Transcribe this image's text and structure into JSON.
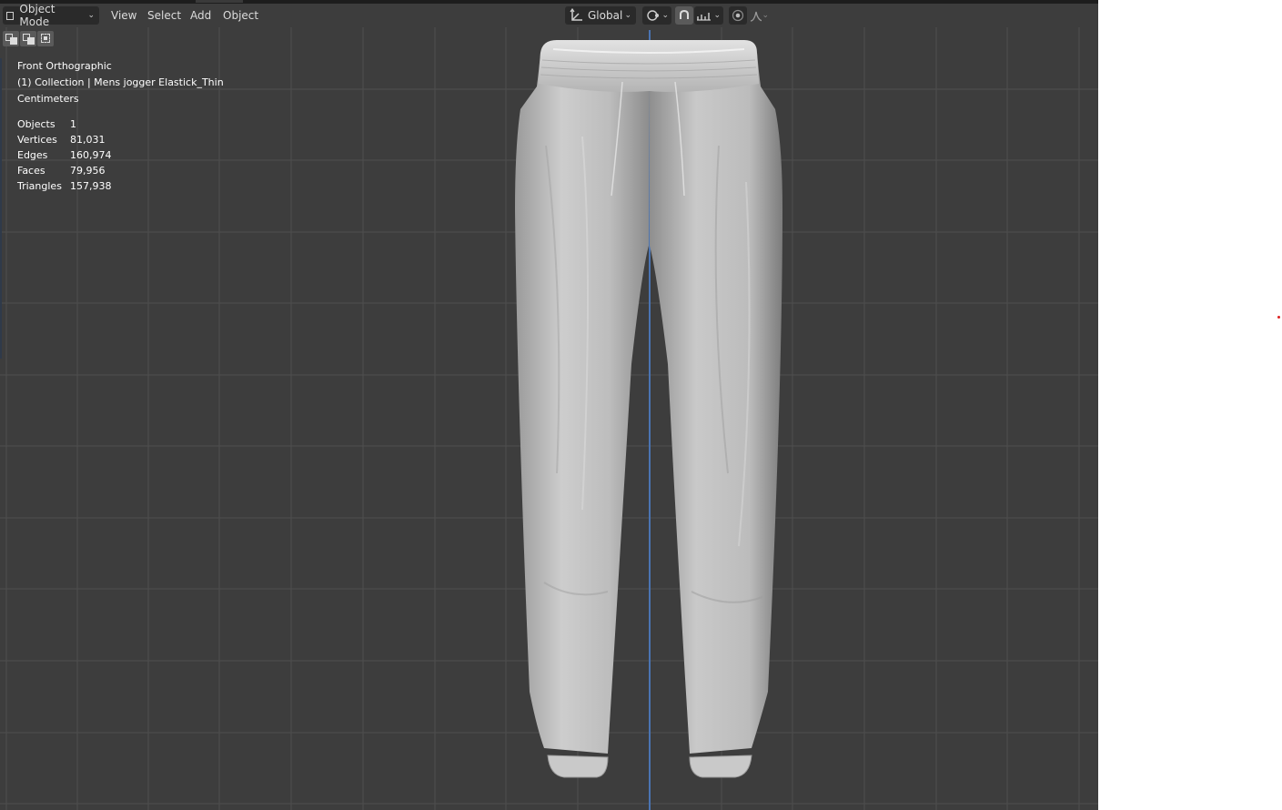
{
  "header": {
    "mode_label": "Object Mode",
    "menus": [
      "View",
      "Select",
      "Add",
      "Object"
    ],
    "transform_orientation": "Global"
  },
  "icons": {
    "mode": "object-mode-cube-icon",
    "orientation": "transform-orientation-icon",
    "pivot": "pivot-point-icon",
    "snap": "snap-magnet-icon",
    "snap_target": "snap-increment-icon",
    "proportional": "proportional-editing-icon",
    "falloff": "falloff-curve-icon"
  },
  "toolbar": {
    "select_modes": [
      "select-new-icon",
      "select-extend-icon",
      "select-subtract-icon"
    ]
  },
  "viewport": {
    "view_name": "Front Orthographic",
    "collection": "(1) Collection | Mens jogger Elastick_Thin",
    "units": "Centimeters",
    "stats": [
      {
        "label": "Objects",
        "value": "1"
      },
      {
        "label": "Vertices",
        "value": "81,031"
      },
      {
        "label": "Edges",
        "value": "160,974"
      },
      {
        "label": "Faces",
        "value": "79,956"
      },
      {
        "label": "Triangles",
        "value": "157,938"
      }
    ]
  },
  "colors": {
    "viewport_bg": "#3d3d3d",
    "grid_line": "#4e4e4e",
    "axis_z": "#4b77b8",
    "header_widget": "#2a2a2a",
    "mesh": "#c4c4c4"
  }
}
